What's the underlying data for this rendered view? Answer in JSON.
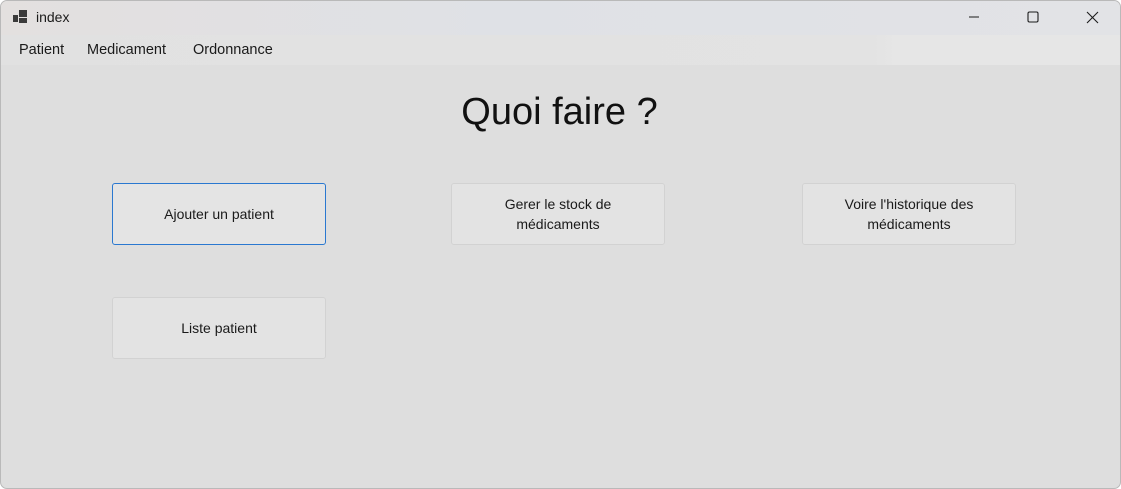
{
  "window": {
    "title": "index",
    "icon": "app-window-icon",
    "controls": {
      "minimize": "minimize-icon",
      "maximize": "maximize-icon",
      "close": "close-icon"
    }
  },
  "menu": {
    "items": [
      {
        "label": "Patient"
      },
      {
        "label": "Medicament"
      },
      {
        "label": "Ordonnance"
      }
    ]
  },
  "main": {
    "heading": "Quoi faire ?",
    "buttons": [
      {
        "label": "Ajouter un patient",
        "focused": true
      },
      {
        "label": "Gerer le stock de médicaments"
      },
      {
        "label": "Voire l'historique des médicaments"
      },
      {
        "label": "Liste patient"
      }
    ]
  },
  "colors": {
    "window_background": "#dedede",
    "focus_border": "#2a78d0"
  }
}
